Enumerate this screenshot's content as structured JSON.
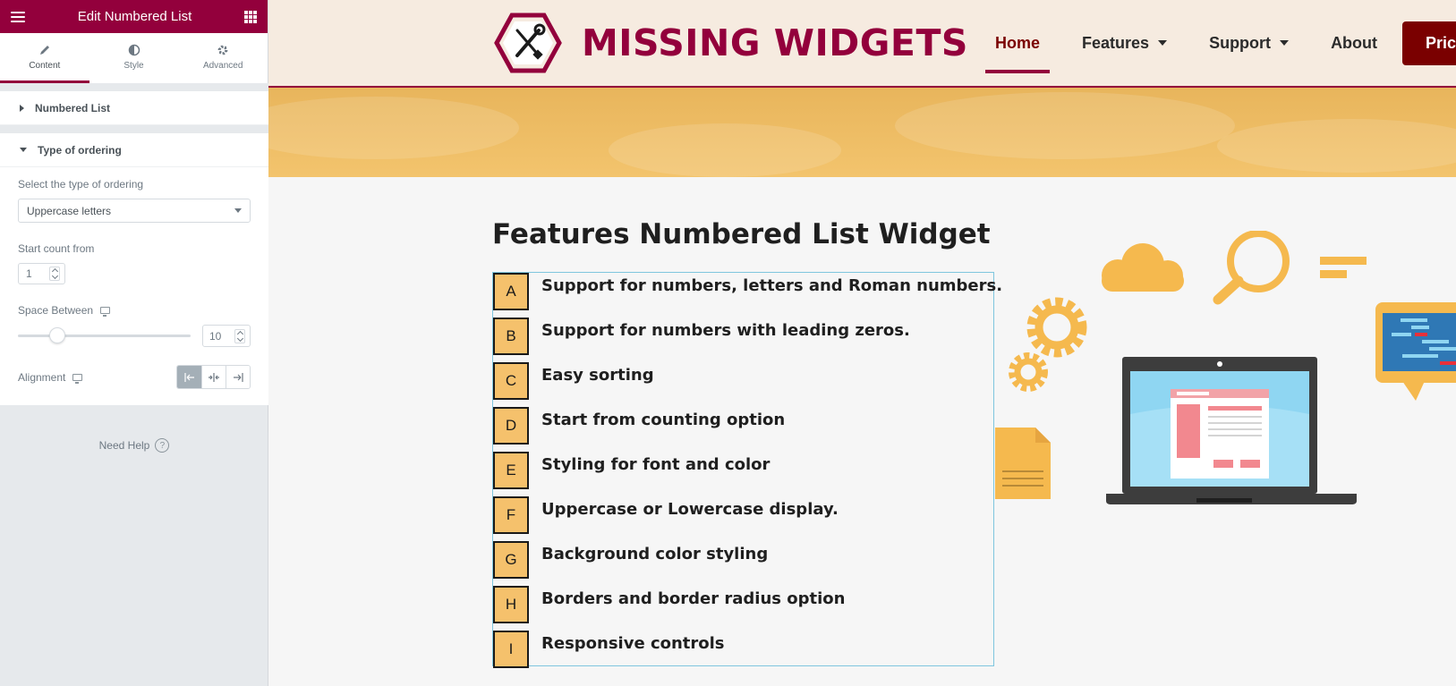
{
  "editor": {
    "title": "Edit Numbered List",
    "tabs": [
      {
        "label": "Content"
      },
      {
        "label": "Style"
      },
      {
        "label": "Advanced"
      }
    ],
    "sections": {
      "numbered_list": "Numbered List",
      "type_of_ordering": "Type of ordering"
    },
    "controls": {
      "ordering_label": "Select the type of ordering",
      "ordering_value": "Uppercase letters",
      "start_label": "Start count from",
      "start_value": "1",
      "space_label": "Space Between",
      "space_value": "10",
      "space_slider_fraction": 0.2,
      "alignment_label": "Alignment"
    },
    "need_help": "Need Help",
    "help_glyph": "?"
  },
  "site": {
    "brand": "MISSING WIDGETS",
    "nav": [
      {
        "label": "Home",
        "active": true
      },
      {
        "label": "Features"
      },
      {
        "label": "Support"
      },
      {
        "label": "About"
      }
    ],
    "pricing_label": "Pricing",
    "page_title": "Features Numbered List Widget",
    "list_items": [
      {
        "marker": "A",
        "text": "Support for numbers, letters and Roman numbers."
      },
      {
        "marker": "B",
        "text": "Support for numbers with leading zeros."
      },
      {
        "marker": "C",
        "text": "Easy sorting"
      },
      {
        "marker": "D",
        "text": "Start from counting option"
      },
      {
        "marker": "E",
        "text": "Styling for font and color"
      },
      {
        "marker": "F",
        "text": "Uppercase or Lowercase display."
      },
      {
        "marker": "G",
        "text": "Background color styling"
      },
      {
        "marker": "H",
        "text": "Borders and border radius option"
      },
      {
        "marker": "I",
        "text": "Responsive controls"
      }
    ]
  },
  "colors": {
    "brand": "#93003c",
    "accent_dark": "#7a0000",
    "badge_fill": "#f5c16c",
    "illustration_orange": "#f5b94e",
    "screen_blue": "#8fd6f2"
  }
}
